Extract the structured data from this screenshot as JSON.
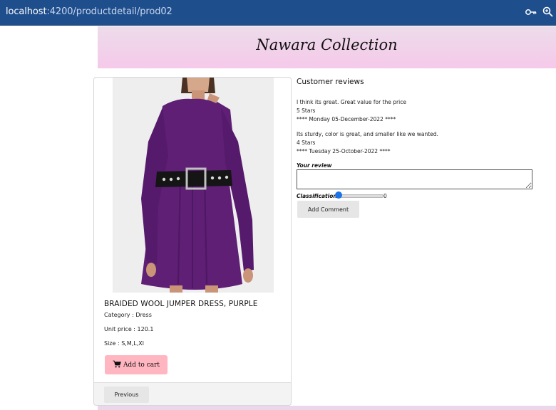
{
  "browser": {
    "url_host": "localhost",
    "url_path": ":4200/productdetail/prod02"
  },
  "header": {
    "brand": "Nawara Collection"
  },
  "product": {
    "image_icon": "product-photo-purple-dress",
    "name": "BRAIDED WOOL JUMPER DRESS, PURPLE",
    "category": "Category : Dress",
    "unit_price": "Unit price : 120.1",
    "size": "Size : S,M,L,Xl",
    "add_to_cart_label": "Add to cart",
    "previous_label": "Previous"
  },
  "reviews": {
    "title": "Customer reviews",
    "items": [
      {
        "text": "I think its great. Great value for the price",
        "stars": "5 Stars",
        "date": "**** Monday 05-December-2022 ****"
      },
      {
        "text": "Its sturdy, color is great, and smaller like we wanted.",
        "stars": "4 Stars",
        "date": "**** Tuesday 25-October-2022 ****"
      }
    ],
    "your_review_label": "Your review",
    "review_value": "",
    "classification_label": "Classification",
    "classification_value": "0",
    "classification_fraction": 0,
    "add_comment_label": "Add Comment"
  },
  "colors": {
    "address_bar": "#1f4e8c",
    "banner_start": "#ecdcea",
    "banner_end": "#f6c9ea",
    "cart_button": "#ffb6c1",
    "slider_thumb": "#1a73e8",
    "dress": "#5e1f75"
  }
}
